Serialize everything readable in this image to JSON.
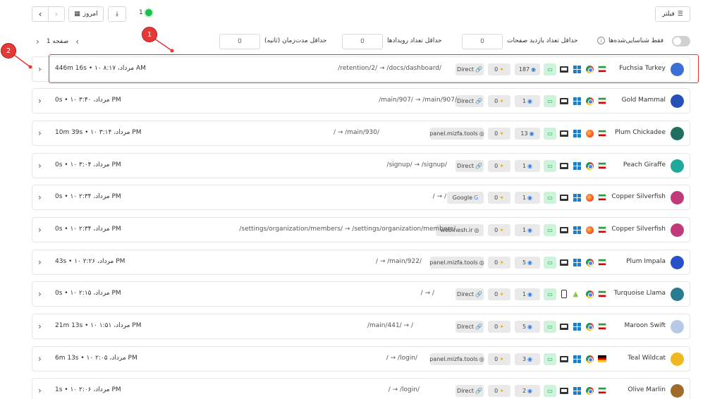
{
  "toolbar": {
    "prev": "‹",
    "next": "›",
    "today_label": "امروز",
    "live_count": "1",
    "filter_label": "فیلتر"
  },
  "pager": {
    "label": "صفحه 1",
    "prev": "‹",
    "next": "›"
  },
  "filters": {
    "min_duration_label": "حداقل مدت‌زمان (ثانیه)",
    "min_duration_value": "0",
    "min_events_label": "حداقل تعداد رویدادها",
    "min_events_value": "0",
    "min_pageviews_label": "حداقل تعداد بازدید صفحات",
    "min_pageviews_value": "0",
    "identified_only_label": "فقط شناسایی‌شده‌ها",
    "identified_only": false
  },
  "annotations": {
    "one": "1",
    "two": "2"
  },
  "sessions": [
    {
      "name": "Fuchsia Turkey",
      "avatar_color": "#3b6fd6",
      "flag": "ir",
      "browser": "chrome",
      "os": "windows",
      "device": "laptop",
      "views": "187",
      "events": "0",
      "referrer": "Direct",
      "path": "/retention/2/  →  /docs/dashboard/",
      "date": "۱۰ مرداد، ۸:۱۷ AM",
      "duration": "446m 16s"
    },
    {
      "name": "Gold Mammal",
      "avatar_color": "#2450b8",
      "flag": "ir",
      "browser": "chrome",
      "os": "windows",
      "device": "laptop",
      "views": "1",
      "events": "0",
      "referrer": "Direct",
      "path": "/main/907/  →  /main/907/",
      "date": "۱۰ مرداد، ۳:۴۰ PM",
      "duration": "0s"
    },
    {
      "name": "Plum Chickadee",
      "avatar_color": "#1f6e5e",
      "flag": "ir",
      "browser": "firefox",
      "os": "windows",
      "device": "laptop",
      "views": "13",
      "events": "0",
      "referrer": "panel.mizfa.tools",
      "path": "/  →  /main/930/",
      "date": "۱۰ مرداد، ۳:۱۴ PM",
      "duration": "10m 39s"
    },
    {
      "name": "Peach Giraffe",
      "avatar_color": "#1fa89a",
      "flag": "ir",
      "browser": "chrome",
      "os": "windows",
      "device": "laptop",
      "views": "1",
      "events": "0",
      "referrer": "Direct",
      "path": "/signup/  →  /signup/",
      "date": "۱۰ مرداد، ۳:۰۴ PM",
      "duration": "0s"
    },
    {
      "name": "Copper Silverfish",
      "avatar_color": "#c03a7a",
      "flag": "ir",
      "browser": "firefox",
      "os": "windows",
      "device": "laptop",
      "views": "1",
      "events": "0",
      "referrer": "Google",
      "path": "/  →  /",
      "date": "۱۰ مرداد، ۲:۳۴ PM",
      "duration": "0s"
    },
    {
      "name": "Copper Silverfish",
      "avatar_color": "#c03a7a",
      "flag": "ir",
      "browser": "firefox",
      "os": "windows",
      "device": "laptop",
      "views": "1",
      "events": "0",
      "referrer": "webinesh.ir",
      "path": "/settings/organization/members/  →  /settings/organization/members/",
      "date": "۱۰ مرداد، ۲:۳۴ PM",
      "duration": "0s"
    },
    {
      "name": "Plum Impala",
      "avatar_color": "#2850c8",
      "flag": "ir",
      "browser": "chrome",
      "os": "windows",
      "device": "laptop",
      "views": "5",
      "events": "0",
      "referrer": "panel.mizfa.tools",
      "path": "/  →  /main/922/",
      "date": "۱۰ مرداد، ۲:۲۶ PM",
      "duration": "43s"
    },
    {
      "name": "Turquoise Llama",
      "avatar_color": "#2a7a90",
      "flag": "ir",
      "browser": "chrome",
      "os": "android",
      "device": "phone",
      "views": "1",
      "events": "0",
      "referrer": "Direct",
      "path": "/  →  /",
      "date": "۱۰ مرداد، ۲:۱۵ PM",
      "duration": "0s"
    },
    {
      "name": "Maroon Swift",
      "avatar_color": "#b8c8e8",
      "flag": "ir",
      "browser": "chrome",
      "os": "windows",
      "device": "laptop",
      "views": "5",
      "events": "0",
      "referrer": "Direct",
      "path": "/main/441/  →  /",
      "date": "۱۰ مرداد، ۱:۵۱ PM",
      "duration": "21m 13s"
    },
    {
      "name": "Teal Wildcat",
      "avatar_color": "#f0b820",
      "flag": "de",
      "browser": "chrome",
      "os": "windows",
      "device": "laptop",
      "views": "3",
      "events": "0",
      "referrer": "panel.mizfa.tools",
      "path": "/  →  /login/",
      "date": "۱۰ مرداد، ۲:۰۵ PM",
      "duration": "6m 13s"
    },
    {
      "name": "Olive Marlin",
      "avatar_color": "#a06a2a",
      "flag": "ir",
      "browser": "chrome",
      "os": "windows",
      "device": "laptop",
      "views": "2",
      "events": "0",
      "referrer": "Direct",
      "path": "/  →  /login/",
      "date": "۱۰ مرداد، ۲:۰۶ PM",
      "duration": "1s"
    }
  ]
}
